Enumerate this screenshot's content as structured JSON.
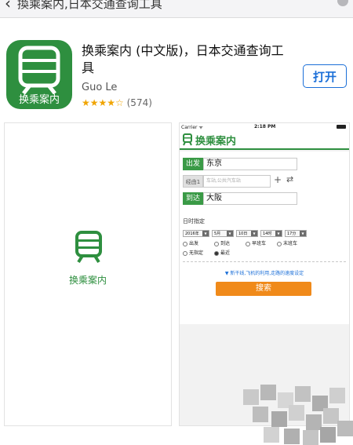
{
  "search": {
    "query": "換乘案内,日本交通查询工具"
  },
  "app": {
    "icon_label": "换乘案内",
    "name": "换乘案内 (中文版)，日本交通查询工具",
    "developer": "Guo Le",
    "stars": "★★★★☆",
    "rating_count": "(574)",
    "open_label": "打开",
    "accent_color": "#2e8f3f"
  },
  "screenshot1": {
    "label": "换乘案内"
  },
  "screenshot2": {
    "status": {
      "carrier": "Carrier ᯤ",
      "time": "2:18 PM"
    },
    "app_title": "换乘案内",
    "from": {
      "tag": "出发",
      "value": "东京"
    },
    "via": {
      "tag": "经由1",
      "placeholder": "车站,公共汽车站"
    },
    "to": {
      "tag": "到达",
      "value": "大阪"
    },
    "date_section": "日时指定",
    "date_selects": [
      "2016年",
      "5月",
      "10日",
      "14时",
      "17分"
    ],
    "radio_row1": [
      "出发",
      "到达",
      "早班车",
      "末班车"
    ],
    "radio_row2": [
      "无指定",
      "最近"
    ],
    "settings_link": "▼ 新干线,飞机的利用,走路的速度设定",
    "search_label": "搜索"
  }
}
